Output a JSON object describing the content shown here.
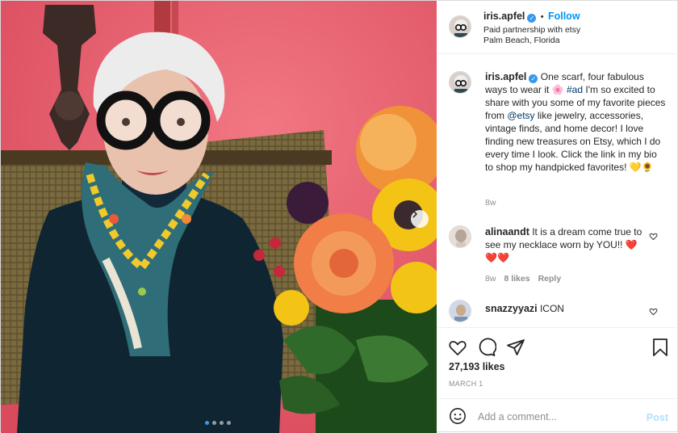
{
  "post": {
    "username": "iris.apfel",
    "follow_label": "Follow",
    "separator": "•",
    "partnership": "Paid partnership with etsy",
    "location": "Palm Beach, Florida",
    "carousel_position": 1,
    "carousel_total": 4
  },
  "caption": {
    "username": "iris.apfel",
    "part1": "One scarf, four fabulous ways to wear it ",
    "emoji1": "🌸",
    "hashtag": "#ad",
    "part2": " I'm so excited to share with you some of my favorite pieces from ",
    "mention": "@etsy",
    "part3": " like jewelry, accessories, vintage finds, and home decor! I love finding new treasures on Etsy, which I do every time I look. Click the link in my bio to shop my handpicked favorites! ",
    "emoji2": "💛🌻",
    "age": "8w"
  },
  "comments": [
    {
      "username": "alinaandt",
      "text": "It is a dream come true to see my necklace worn by YOU!! ",
      "emoji": "❤️❤️❤️",
      "age": "8w",
      "likes": "8 likes",
      "reply_label": "Reply"
    },
    {
      "username": "snazzyyazi",
      "text": "ICON"
    }
  ],
  "stats": {
    "likes": "27,193 likes",
    "date": "MARCH 1"
  },
  "composer": {
    "placeholder": "Add a comment...",
    "post_label": "Post"
  },
  "colors": {
    "accent": "#0095f6",
    "verified": "#3897f0",
    "post_disabled": "#b2dffc"
  },
  "icons": [
    "verified-icon",
    "heart-icon",
    "comment-icon",
    "share-icon",
    "save-icon",
    "emoji-icon",
    "next-arrow-icon"
  ]
}
